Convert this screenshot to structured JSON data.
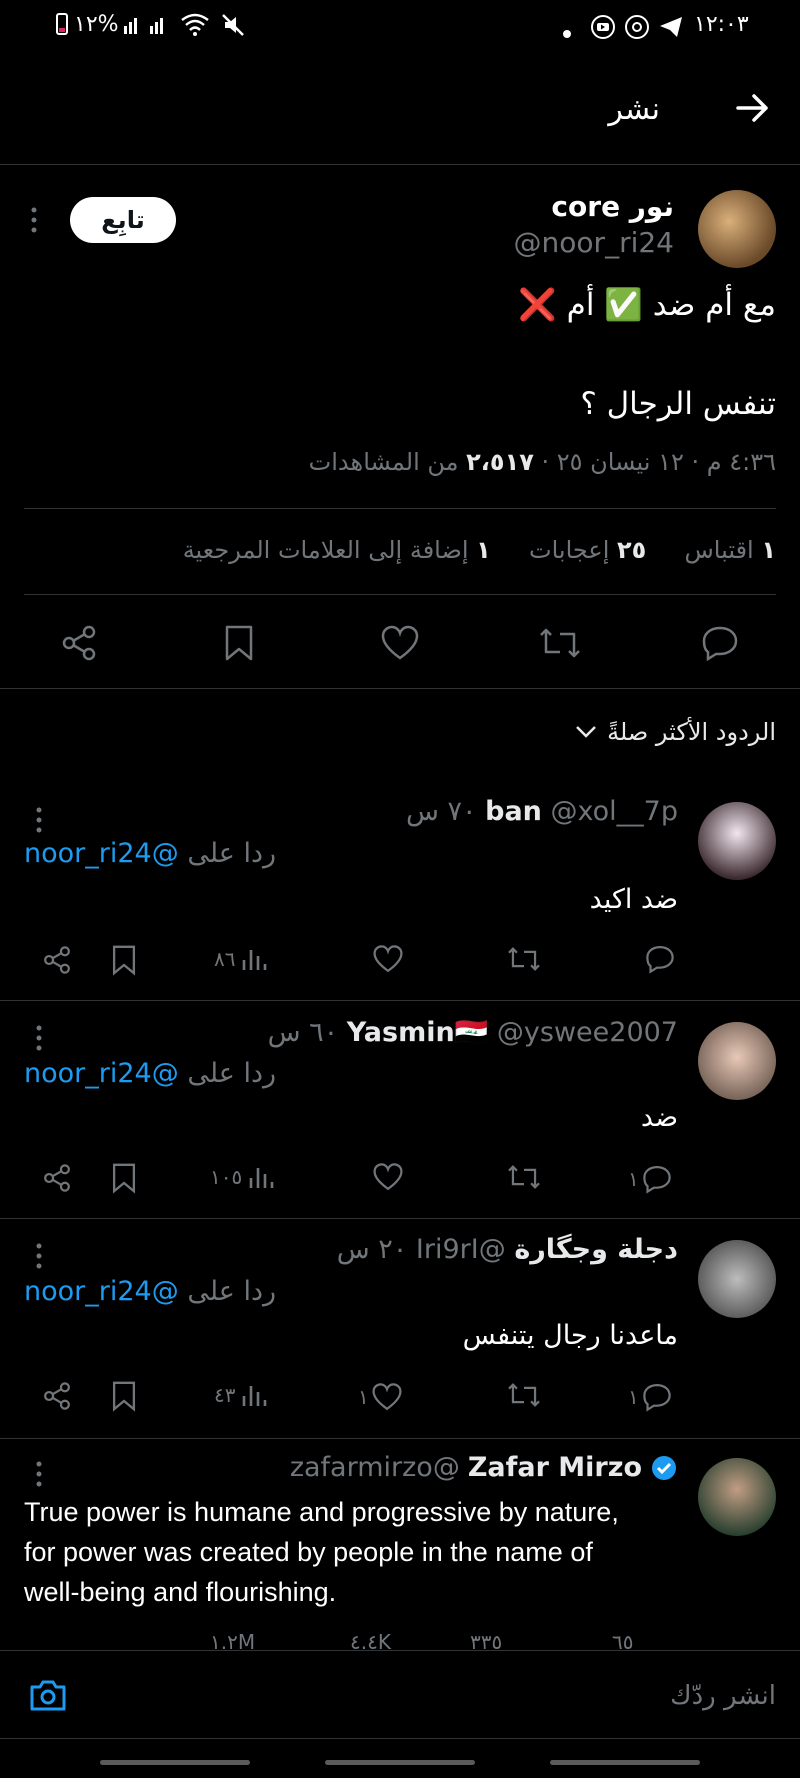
{
  "status_bar": {
    "time": "١٢:٠٣",
    "battery_percent": "١٢%"
  },
  "header": {
    "title": "نشر"
  },
  "tweet": {
    "author_name": "نور core",
    "author_handle": "@noor_ri24",
    "follow_label": "تابِع",
    "text_line1": "مع أم ضد ✅ أم ❌",
    "text_line2": "تنفس الرجال ؟",
    "meta_time_date": "٤:٣٦ م · ١٢ نيسان ٢٥ · ",
    "views_count": "٢،٥١٧",
    "views_label": " من المشاهدات",
    "stats": {
      "quotes_count": "١",
      "quotes_label": "اقتباس",
      "likes_count": "٢٥",
      "likes_label": "إعجابات",
      "bookmarks_count": "١",
      "bookmarks_label": "إضافة إلى العلامات المرجعية"
    }
  },
  "replies_filter": {
    "label": "الردود الأكثر صلةً"
  },
  "replies": [
    {
      "name": "ban",
      "handle": "@xol__7p",
      "time": "٧٠ س",
      "replying_prefix": "ردا على",
      "replying_to": "@noor_ri24",
      "text": "ضد اكيد",
      "reply_count": "",
      "retweet_count": "",
      "like_count": "",
      "views": "٨٦"
    },
    {
      "name": "Yasmin🇮🇶",
      "handle": "@yswee2007",
      "time": "٦٠ س",
      "replying_prefix": "ردا على",
      "replying_to": "@noor_ri24",
      "text": "ضد",
      "reply_count": "١",
      "retweet_count": "",
      "like_count": "",
      "views": "١٠٥"
    },
    {
      "name": "دجلة وجگارة",
      "handle": "@Iri9rI",
      "time": "٢٠ س",
      "replying_prefix": "ردا على",
      "replying_to": "@noor_ri24",
      "text": "ماعدنا رجال يتنفس",
      "reply_count": "١",
      "retweet_count": "",
      "like_count": "١",
      "views": "٤٣"
    }
  ],
  "ad": {
    "name": "Zafar Mirzo",
    "handle": "@zafarmirzo",
    "text": "True power is humane and progressive by nature, for power was created by people in the name of well-being and flourishing.",
    "reply_count": "٦٥",
    "retweet_count": "٣٣٥",
    "like_count": "٤.٤K",
    "views": "١.٢M"
  },
  "composer": {
    "placeholder": "انشر ردّك"
  },
  "colors": {
    "background": "#000000",
    "accent": "#1d9bf0",
    "muted": "#71767b",
    "divider": "#2f3336"
  }
}
